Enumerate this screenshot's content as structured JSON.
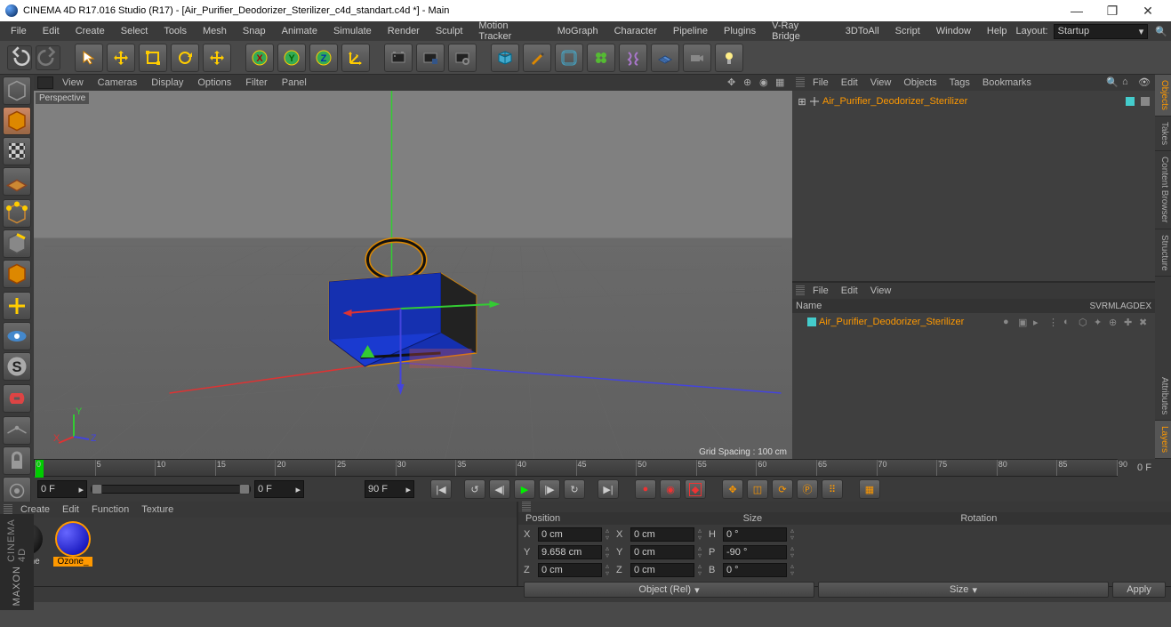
{
  "title": "CINEMA 4D R17.016 Studio (R17) - [Air_Purifier_Deodorizer_Sterilizer_c4d_standart.c4d *] - Main",
  "menu": [
    "File",
    "Edit",
    "Create",
    "Select",
    "Tools",
    "Mesh",
    "Snap",
    "Animate",
    "Simulate",
    "Render",
    "Sculpt",
    "Motion Tracker",
    "MoGraph",
    "Character",
    "Pipeline",
    "Plugins",
    "V-Ray Bridge",
    "",
    "3DToAll",
    "Script",
    "Window",
    "Help"
  ],
  "layout_label": "Layout:",
  "layout_value": "Startup",
  "viewport_menu": [
    "View",
    "Cameras",
    "Display",
    "Options",
    "Filter",
    "Panel"
  ],
  "viewport_label": "Perspective",
  "grid_spacing": "Grid Spacing : 100 cm",
  "objects_menu": [
    "File",
    "Edit",
    "View",
    "Objects",
    "Tags",
    "Bookmarks"
  ],
  "object_name": "Air_Purifier_Deodorizer_Sterilizer",
  "attr_menu": [
    "File",
    "Edit",
    "View"
  ],
  "attr_name_label": "Name",
  "attr_cols": [
    "S",
    "V",
    "R",
    "M",
    "L",
    "A",
    "G",
    "D",
    "E",
    "X"
  ],
  "attr_obj_name": "Air_Purifier_Deodorizer_Sterilizer",
  "side_tabs_top": [
    "Objects",
    "Takes",
    "Content Browser",
    "Structure"
  ],
  "side_tabs_bottom": [
    "Attributes",
    "Layers"
  ],
  "timeline": {
    "start": 0,
    "end": 90,
    "step": 5,
    "end_label": "0 F"
  },
  "playback": {
    "cur": "0 F",
    "rs": "0 F",
    "re": "90 F"
  },
  "mat_menu": [
    "Create",
    "Edit",
    "Function",
    "Texture"
  ],
  "materials": [
    {
      "name": "Ozone",
      "color": "radial-gradient(circle at 30% 30%,#555,#000)"
    },
    {
      "name": "Ozone_",
      "color": "radial-gradient(circle at 30% 30%,#66f,#00a)",
      "selected": true
    }
  ],
  "coord_labels": [
    "Position",
    "Size",
    "Rotation"
  ],
  "coords": {
    "pos": {
      "X": "0 cm",
      "Y": "9.658 cm",
      "Z": "0 cm"
    },
    "size": {
      "X": "0 cm",
      "Y": "0 cm",
      "Z": "0 cm"
    },
    "rot": {
      "H": "0 °",
      "P": "-90 °",
      "B": "0 °"
    }
  },
  "coord_mode": "Object (Rel)",
  "size_mode": "Size",
  "apply": "Apply",
  "maxon": "MAXON",
  "c4d": "CINEMA 4D"
}
